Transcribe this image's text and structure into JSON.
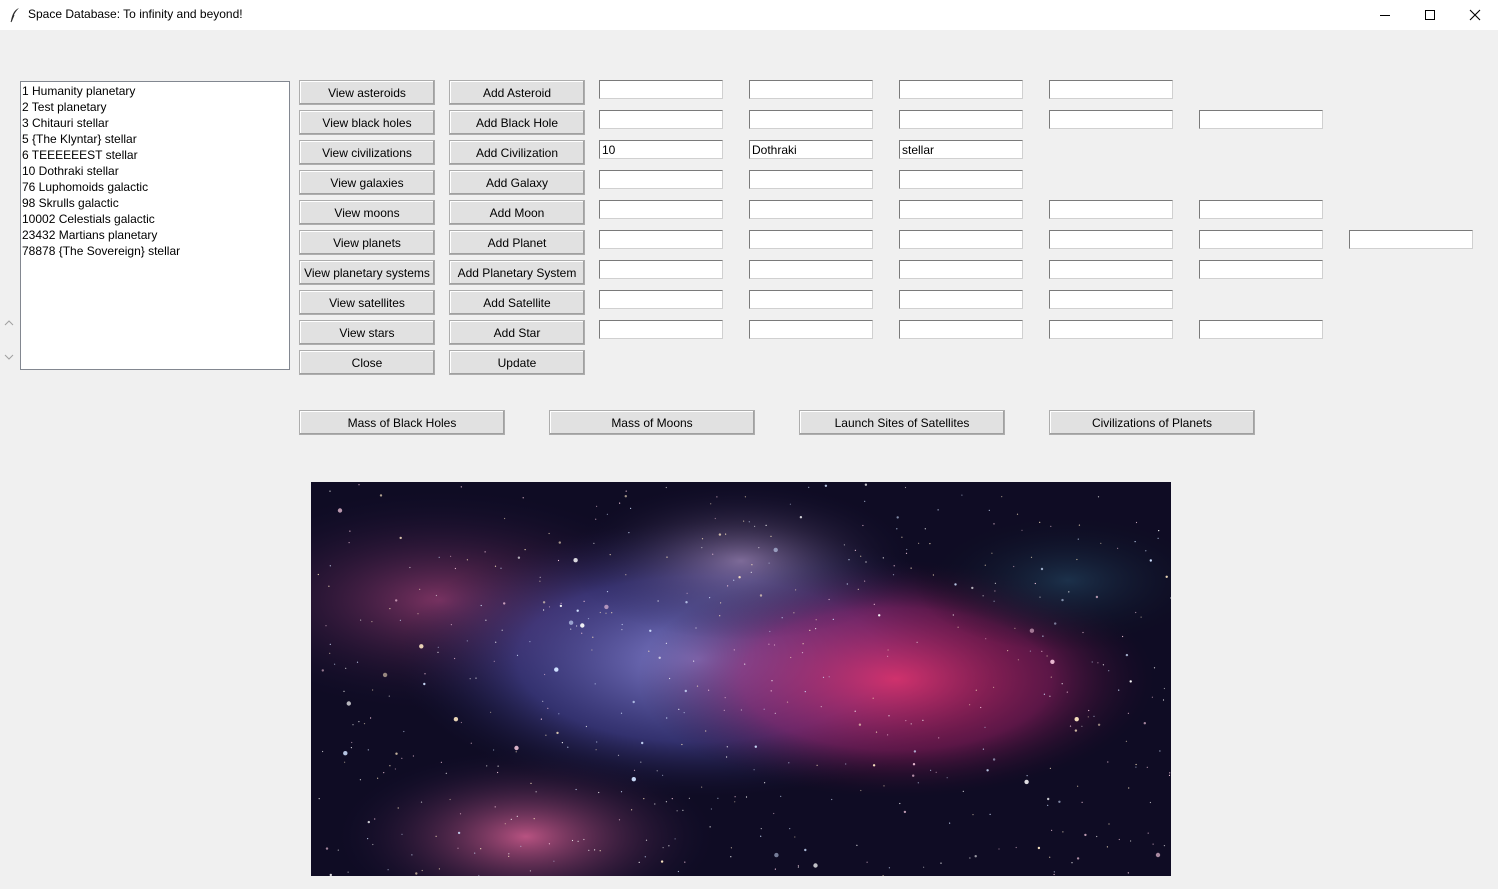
{
  "window": {
    "title": "Space Database: To infinity and beyond!",
    "icon": "feather-icon",
    "controls": [
      "minimize-icon",
      "maximize-icon",
      "close-icon"
    ]
  },
  "listbox": {
    "items": [
      "1 Humanity planetary",
      "2 Test planetary",
      "3 Chitauri stellar",
      "5 {The Klyntar} stellar",
      "6 TEEEEEEST stellar",
      "10 Dothraki stellar",
      "76 Luphomoids galactic",
      "98 Skrulls galactic",
      "10002 Celestials galactic",
      "23432 Martians planetary",
      "78878 {The Sovereign} stellar"
    ]
  },
  "view_buttons": [
    "View asteroids",
    "View black holes",
    "View civilizations",
    "View galaxies",
    "View moons",
    "View planets",
    "View planetary systems",
    "View satellites",
    "View stars",
    "Close"
  ],
  "add_buttons": [
    "Add Asteroid",
    "Add Black Hole",
    "Add Civilization",
    "Add Galaxy",
    "Add Moon",
    "Add Planet",
    "Add Planetary System",
    "Add Satellite",
    "Add Star",
    "Update"
  ],
  "entry_rows": {
    "asteroid": [
      "",
      "",
      "",
      ""
    ],
    "black_hole": [
      "",
      "",
      "",
      "",
      ""
    ],
    "civilization": [
      "10",
      "Dothraki",
      "stellar"
    ],
    "galaxy": [
      "",
      "",
      ""
    ],
    "moon": [
      "",
      "",
      "",
      "",
      ""
    ],
    "planet": [
      "",
      "",
      "",
      "",
      "",
      ""
    ],
    "planetary_system": [
      "",
      "",
      "",
      "",
      ""
    ],
    "satellite": [
      "",
      "",
      "",
      ""
    ],
    "star": [
      "",
      "",
      "",
      "",
      ""
    ]
  },
  "query_buttons": [
    "Mass of Black Holes",
    "Mass of Moons",
    "Launch Sites of Satellites",
    "Civilizations of Planets"
  ],
  "image": {
    "subject": "nebula-image"
  }
}
